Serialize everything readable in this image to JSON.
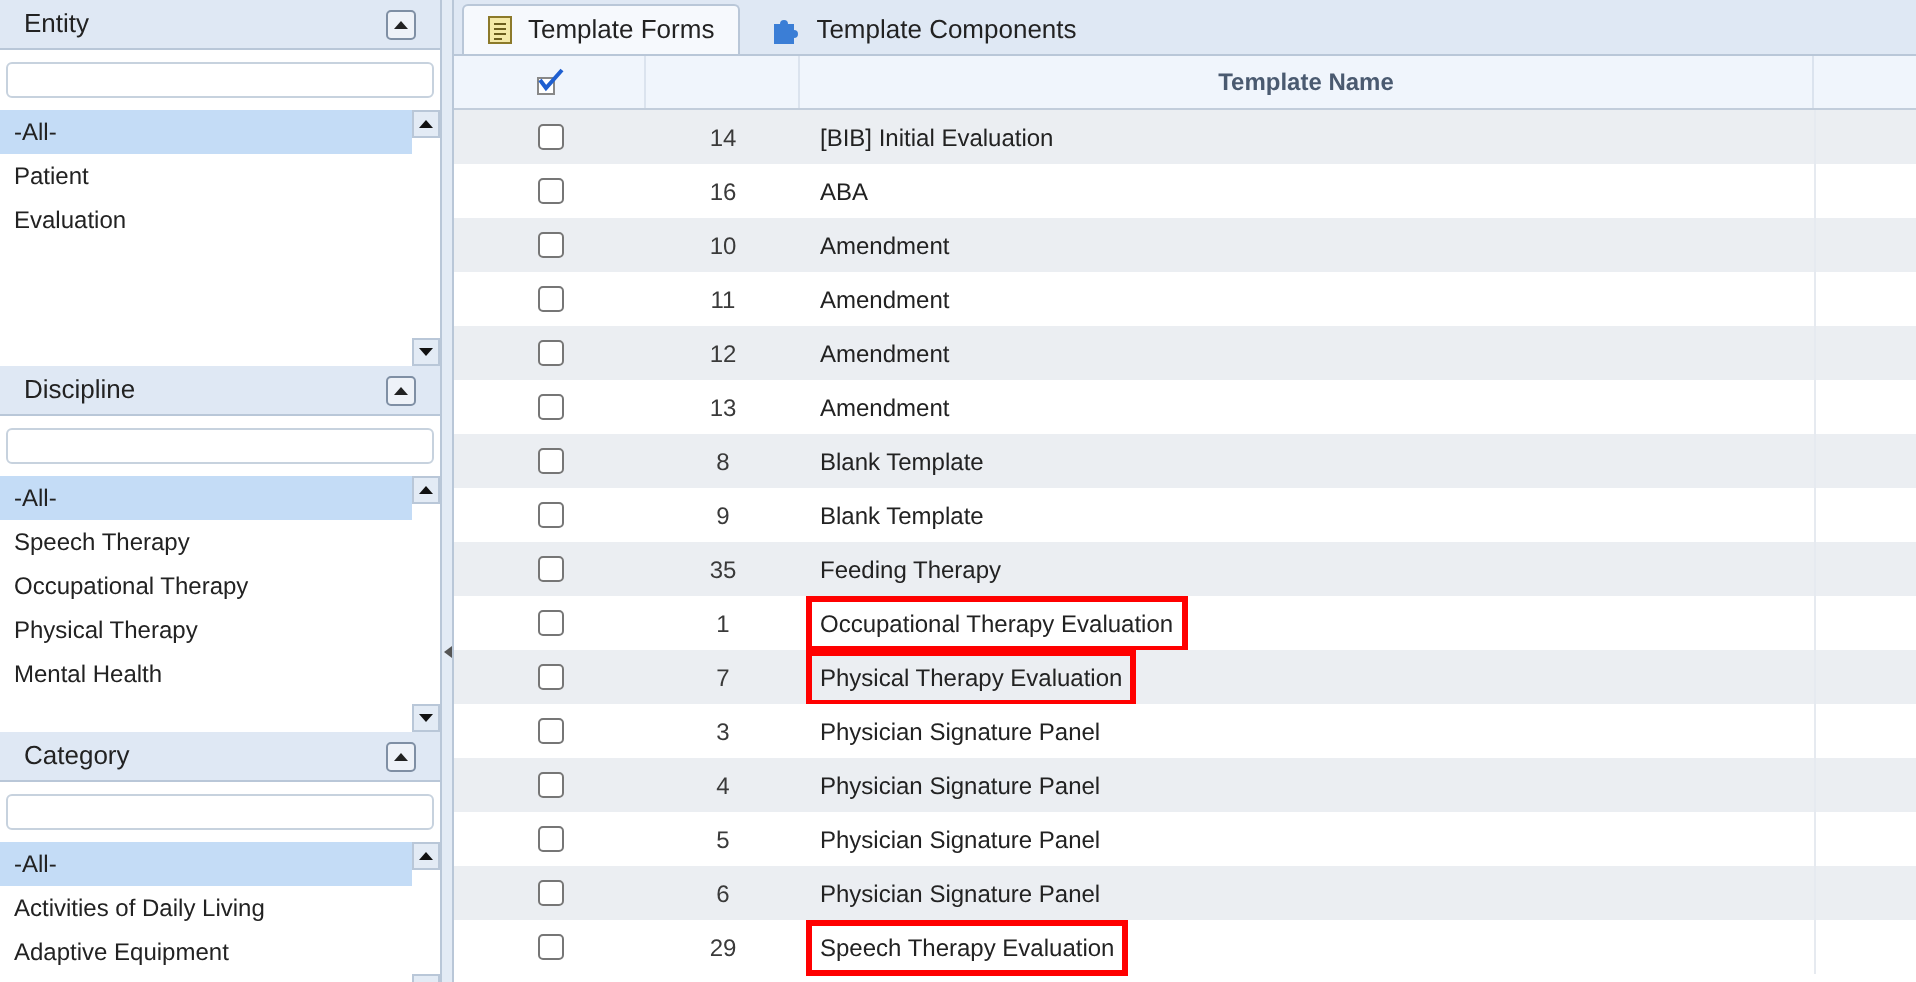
{
  "filters": [
    {
      "title": "Entity",
      "items": [
        {
          "label": "-All-",
          "selected": true
        },
        {
          "label": "Patient",
          "selected": false
        },
        {
          "label": "Evaluation",
          "selected": false
        }
      ]
    },
    {
      "title": "Discipline",
      "items": [
        {
          "label": "-All-",
          "selected": true
        },
        {
          "label": "Speech Therapy",
          "selected": false
        },
        {
          "label": "Occupational Therapy",
          "selected": false
        },
        {
          "label": "Physical Therapy",
          "selected": false
        },
        {
          "label": "Mental Health",
          "selected": false
        }
      ]
    },
    {
      "title": "Category",
      "items": [
        {
          "label": "-All-",
          "selected": true
        },
        {
          "label": "Activities of Daily Living",
          "selected": false
        },
        {
          "label": "Adaptive Equipment",
          "selected": false
        }
      ]
    }
  ],
  "tabs": [
    {
      "label": "Template Forms",
      "selected": true,
      "kind": "form"
    },
    {
      "label": "Template Components",
      "selected": false,
      "kind": "component"
    }
  ],
  "table": {
    "columns": [
      "Template Name"
    ],
    "rows": [
      {
        "id": "14",
        "name": "[BIB] Initial Evaluation",
        "checked": false,
        "highlighted": false
      },
      {
        "id": "16",
        "name": "ABA",
        "checked": false,
        "highlighted": false
      },
      {
        "id": "10",
        "name": "Amendment",
        "checked": false,
        "highlighted": false
      },
      {
        "id": "11",
        "name": "Amendment",
        "checked": false,
        "highlighted": false
      },
      {
        "id": "12",
        "name": "Amendment",
        "checked": false,
        "highlighted": false
      },
      {
        "id": "13",
        "name": "Amendment",
        "checked": false,
        "highlighted": false
      },
      {
        "id": "8",
        "name": "Blank Template",
        "checked": false,
        "highlighted": false
      },
      {
        "id": "9",
        "name": "Blank Template",
        "checked": false,
        "highlighted": false
      },
      {
        "id": "35",
        "name": "Feeding Therapy",
        "checked": false,
        "highlighted": false
      },
      {
        "id": "1",
        "name": "Occupational Therapy Evaluation",
        "checked": false,
        "highlighted": true
      },
      {
        "id": "7",
        "name": "Physical Therapy Evaluation",
        "checked": false,
        "highlighted": true
      },
      {
        "id": "3",
        "name": "Physician Signature Panel",
        "checked": false,
        "highlighted": false
      },
      {
        "id": "4",
        "name": "Physician Signature Panel",
        "checked": false,
        "highlighted": false
      },
      {
        "id": "5",
        "name": "Physician Signature Panel",
        "checked": false,
        "highlighted": false
      },
      {
        "id": "6",
        "name": "Physician Signature Panel",
        "checked": false,
        "highlighted": false
      },
      {
        "id": "29",
        "name": "Speech Therapy Evaluation",
        "checked": false,
        "highlighted": true
      }
    ]
  }
}
